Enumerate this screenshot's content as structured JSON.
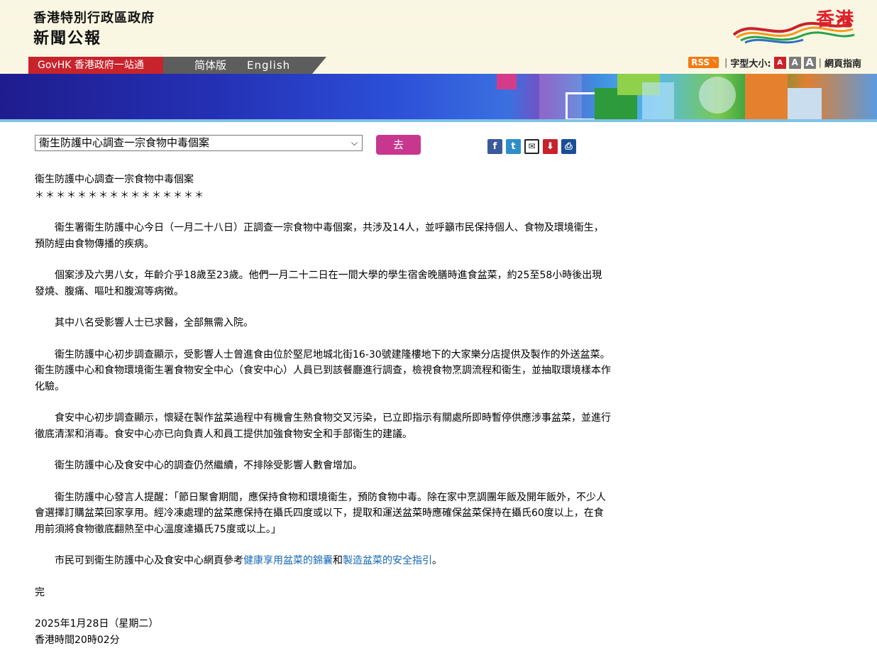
{
  "header": {
    "title_line1": "香港特別行政區政府",
    "title_line2": "新聞公報",
    "brand": "香港"
  },
  "nav": {
    "govhk": "GovHK 香港政府一站通",
    "simplified": "简体版",
    "english": "English"
  },
  "tools": {
    "rss": "RSS",
    "font_size_label": "字型大小:",
    "font_small": "A",
    "font_medium": "A",
    "font_large": "A",
    "guide": "網頁指南"
  },
  "toolbar": {
    "select_value": "衞生防護中心調查一宗食物中毒個案",
    "go_button": "去"
  },
  "share_icons": [
    "facebook-icon",
    "twitter-icon",
    "email-icon",
    "save-icon",
    "print-icon"
  ],
  "article": {
    "title": "衞生防護中心調查一宗食物中毒個案",
    "stars": "＊＊＊＊＊＊＊＊＊＊＊＊＊＊＊＊",
    "paragraphs": [
      "　　衞生署衞生防護中心今日（一月二十八日）正調查一宗食物中毒個案，共涉及14人，並呼籲市民保持個人、食物及環境衞生，預防經由食物傳播的疾病。",
      "　　個案涉及六男八女，年齡介乎18歲至23歲。他們一月二十二日在一間大學的學生宿舍晚膳時進食盆菜，約25至58小時後出現發燒、腹痛、嘔吐和腹瀉等病徵。",
      "　　其中八名受影響人士已求醫，全部無需入院。",
      "　　衞生防護中心初步調查顯示，受影響人士曾進食由位於堅尼地城北街16-30號建隆樓地下的大家樂分店提供及製作的外送盆菜。衞生防護中心和食物環境衞生署食物安全中心（食安中心）人員已到該餐廳進行調查，檢視食物烹調流程和衞生，並抽取環境樣本作化驗。",
      "　　食安中心初步調查顯示，懷疑在製作盆菜過程中有機會生熟食物交叉污染，已立即指示有關處所即時暫停供應涉事盆菜，並進行徹底清潔和消毒。食安中心亦已向負責人和員工提供加強食物安全和手部衞生的建議。",
      "　　衞生防護中心及食安中心的調查仍然繼續，不排除受影響人數會增加。",
      "　　衞生防護中心發言人提醒：「節日聚會期間，應保持食物和環境衞生，預防食物中毒。除在家中烹調團年飯及開年飯外，不少人會選擇訂購盆菜回家享用。經冷凍處理的盆菜應保持在攝氏四度或以下，提取和運送盆菜時應確保盆菜保持在攝氏60度以上，在食用前須將食物徹底翻熱至中心溫度達攝氏75度或以上。」"
    ],
    "last_para_prefix": "　　市民可到衞生防護中心及食安中心網頁參考",
    "link1": "健康享用盆菜的錦囊",
    "and_text": "和",
    "link2": "製造盆菜的安全指引",
    "last_para_suffix": "。",
    "end": "完",
    "date": "2025年1月28日（星期二）",
    "time": "香港時間20時02分"
  }
}
